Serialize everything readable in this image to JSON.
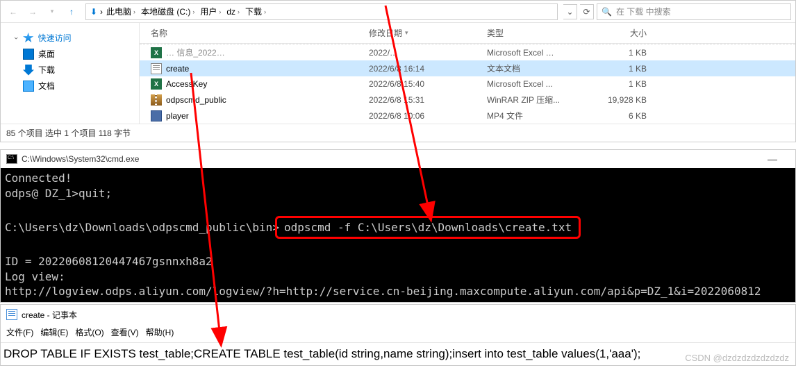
{
  "explorer": {
    "breadcrumb": [
      "此电脑",
      "本地磁盘 (C:)",
      "用户",
      "dz",
      "下载"
    ],
    "search_placeholder": "在 下载 中搜索",
    "sidebar": {
      "quick_access": "快速访问",
      "desktop": "桌面",
      "downloads": "下载",
      "documents": "文档"
    },
    "columns": {
      "name": "名称",
      "date": "修改日期",
      "type": "类型",
      "size": "大小"
    },
    "rows": [
      {
        "icon": "xls",
        "name": "… 信息_2022… ",
        "date": "2022/…",
        "type": "Microsoft Excel …",
        "size": "1 KB",
        "truncated": true
      },
      {
        "icon": "txt",
        "name": "create",
        "date": "2022/6/8 16:14",
        "type": "文本文档",
        "size": "1 KB",
        "selected": true
      },
      {
        "icon": "xls",
        "name": "AccessKey",
        "date": "2022/6/8 15:40",
        "type": "Microsoft Excel ...",
        "size": "1 KB"
      },
      {
        "icon": "zip",
        "name": "odpscmd_public",
        "date": "2022/6/8 15:31",
        "type": "WinRAR ZIP 压缩...",
        "size": "19,928 KB"
      },
      {
        "icon": "mp4",
        "name": "player",
        "date": "2022/6/8 10:06",
        "type": "MP4 文件",
        "size": "6 KB"
      }
    ],
    "status": "85 个项目    选中 1 个项目  118 字节"
  },
  "cmd": {
    "title": "C:\\Windows\\System32\\cmd.exe",
    "lines_before": "Connected!\nodps@ DZ_1>quit;\n\n",
    "prompt_path": "C:\\Users\\dz\\Downloads\\odpscmd_public\\bin>",
    "highlighted_command": "odpscmd -f C:\\Users\\dz\\Downloads\\create.txt",
    "lines_after": "\nID = 20220608120447467gsnnxh8a2\nLog view:\nhttp://logview.odps.aliyun.com/logview/?h=http://service.cn-beijing.maxcompute.aliyun.com/api&p=DZ_1&i=2022060812"
  },
  "notepad": {
    "title": "create - 记事本",
    "menu": [
      "文件(F)",
      "编辑(E)",
      "格式(O)",
      "查看(V)",
      "帮助(H)"
    ],
    "content": "DROP TABLE IF EXISTS test_table;CREATE TABLE test_table(id string,name string);insert into test_table values(1,'aaa');"
  },
  "watermark": "CSDN @dzdzdzdzdzdzdz"
}
